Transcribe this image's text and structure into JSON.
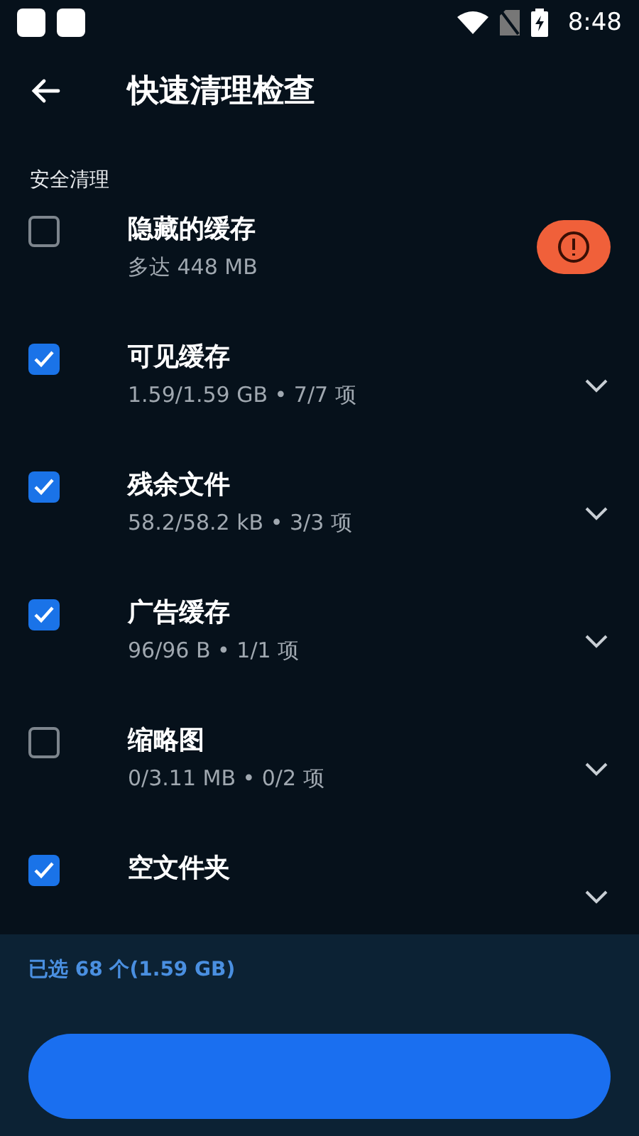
{
  "status_bar": {
    "time": "8:48"
  },
  "header": {
    "title": "快速清理检查"
  },
  "section": {
    "title": "安全清理"
  },
  "items": [
    {
      "title": "隐藏的缓存",
      "subtitle": "多达 448 MB",
      "checked": false,
      "kind": "alert"
    },
    {
      "title": "可见缓存",
      "subtitle": "1.59/1.59 GB • 7/7 项",
      "checked": true,
      "kind": "expand"
    },
    {
      "title": "残余文件",
      "subtitle": "58.2/58.2 kB • 3/3 项",
      "checked": true,
      "kind": "expand"
    },
    {
      "title": "广告缓存",
      "subtitle": "96/96 B • 1/1 项",
      "checked": true,
      "kind": "expand"
    },
    {
      "title": "缩略图",
      "subtitle": "0/3.11 MB • 0/2 项",
      "checked": false,
      "kind": "expand"
    },
    {
      "title": "空文件夹",
      "checked": true,
      "kind": "expand"
    }
  ],
  "footer": {
    "summary": "已选 68 个(1.59 GB)"
  }
}
